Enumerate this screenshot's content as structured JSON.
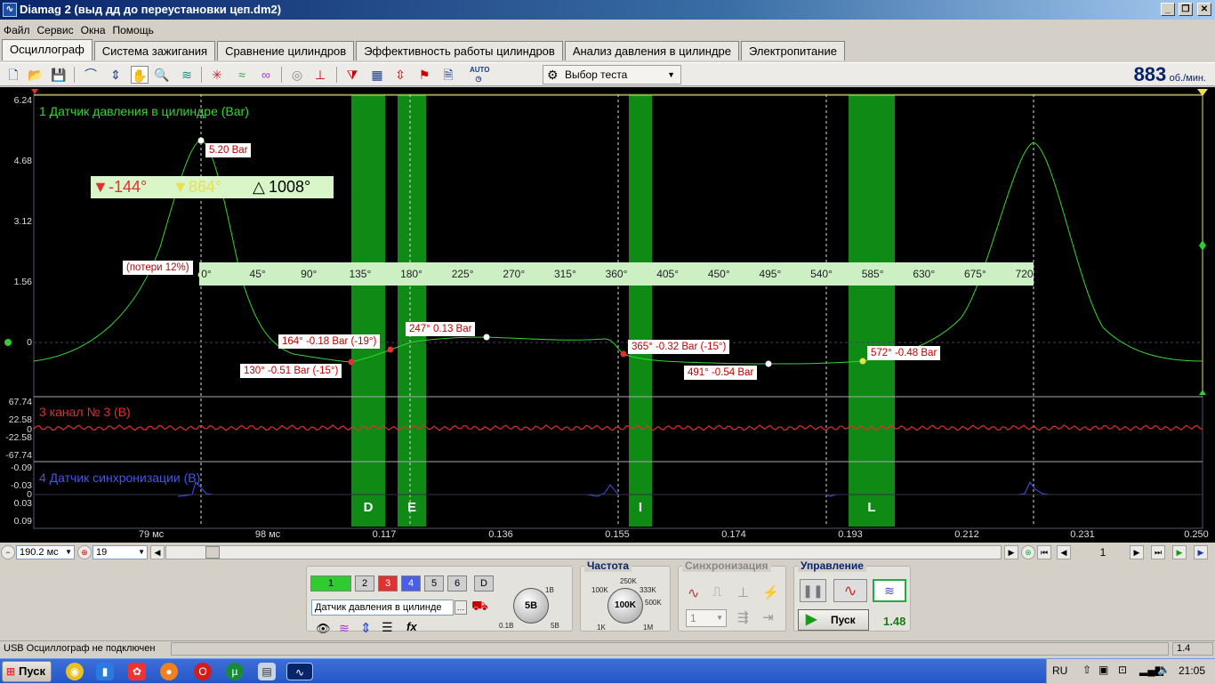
{
  "window": {
    "title": "Diamag 2 (выд дд до переустановки цеп.dm2)",
    "app_icon": "waveform-icon"
  },
  "menu": [
    "Файл",
    "Сервис",
    "Окна",
    "Помощь"
  ],
  "tabs": [
    "Осциллограф",
    "Система зажигания",
    "Сравнение цилиндров",
    "Эффективность работы цилиндров",
    "Анализ давления в цилиндре",
    "Электропитание"
  ],
  "toolbar": {
    "test_select": "Выбор теста",
    "auto_label": "AUTO",
    "rpm_value": "883",
    "rpm_unit": "об./мин."
  },
  "scope": {
    "ch1_title": "1 Датчик давления в цилиндре (Bar)",
    "ch3_title": "3 канал № 3 (В)",
    "ch4_title": "4 Датчик синхронизации (В)",
    "ch1_yticks": [
      "6.24",
      "4.68",
      "3.12",
      "1.56",
      "0"
    ],
    "ch3_yticks": [
      "67.74",
      "22.58",
      "0",
      "-22.58",
      "-67.74"
    ],
    "ch4_yticks": [
      "-0.09",
      "-0.03",
      "0",
      "0.03",
      "0.09"
    ],
    "xticks": [
      "79 мс",
      "98 мс",
      "0.117",
      "0.136",
      "0.155",
      "0.174",
      "0.193",
      "0.212",
      "0.231",
      "0.250"
    ],
    "markers": {
      "red": "-144°",
      "yellow": "864°",
      "delta": "1008°"
    },
    "ruler": [
      "0°",
      "45°",
      "90°",
      "135°",
      "180°",
      "225°",
      "270°",
      "315°",
      "360°",
      "405°",
      "450°",
      "495°",
      "540°",
      "585°",
      "630°",
      "675°",
      "720°"
    ],
    "annotations": {
      "peak": "5.20 Bar",
      "loss": "(потери 12%)",
      "a130": "130° -0.51 Bar (-15°)",
      "a164": "164° -0.18 Bar (-19°)",
      "a247": "247° 0.13 Bar",
      "a365": "365° -0.32 Bar (-15°)",
      "a491": "491° -0.54 Bar",
      "a572": "572° -0.48 Bar"
    },
    "zones": [
      "D",
      "E",
      "I",
      "L"
    ],
    "colors": {
      "ch1": "#33d633",
      "ch3": "#e03030",
      "ch4": "#4455ee",
      "zone": "#0f8a14"
    }
  },
  "bottom": {
    "timebase": "190.2 мс",
    "trigger": "19",
    "page": "1"
  },
  "channels_panel": {
    "buttons": [
      "1",
      "2",
      "3",
      "4",
      "5",
      "6",
      "D"
    ],
    "sensor": "Датчик давления в цилинде",
    "knob_value": "5В",
    "knob_ticks": [
      "1В",
      "0.1В",
      "5В"
    ]
  },
  "freq_panel": {
    "title": "Частота",
    "knob_value": "100K",
    "ticks": [
      "250K",
      "100K",
      "333K",
      "500K",
      "1K",
      "1M"
    ]
  },
  "sync_panel": {
    "title": "Синхронизация",
    "select": "1"
  },
  "control_panel": {
    "title": "Управление",
    "start": "Пуск",
    "value": "1.48"
  },
  "status": {
    "left": "USB Осциллограф не подключен",
    "right": "1.4"
  },
  "taskbar": {
    "start": "Пуск",
    "lang": "RU",
    "time": "21:05"
  }
}
